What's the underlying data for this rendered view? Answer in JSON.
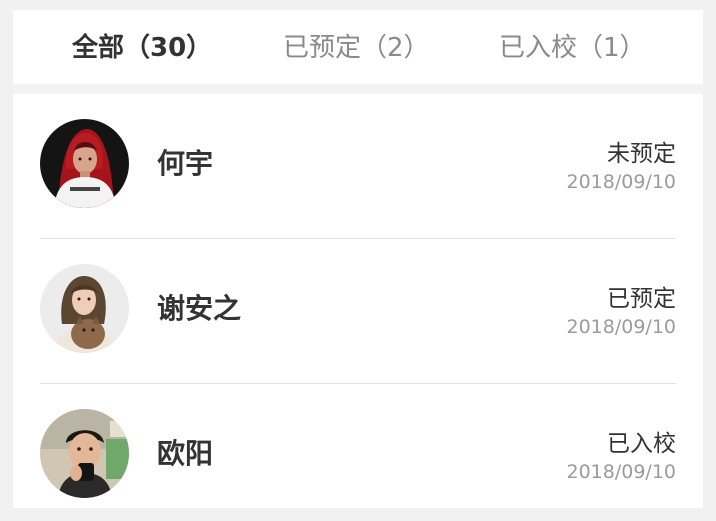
{
  "tabs": [
    {
      "label": "全部（30）",
      "active": true
    },
    {
      "label": "已预定（2）",
      "active": false
    },
    {
      "label": "已入校（1）",
      "active": false
    }
  ],
  "students": [
    {
      "name": "何宇",
      "status": "未预定",
      "date": "2018/09/10"
    },
    {
      "name": "谢安之",
      "status": "已预定",
      "date": "2018/09/10"
    },
    {
      "name": "欧阳",
      "status": "已入校",
      "date": "2018/09/10"
    }
  ],
  "colors": {
    "active_tab": "#333333",
    "inactive_tab": "#8a8a8a",
    "date": "#9b9b9b",
    "divider": "#e2e2e2"
  }
}
